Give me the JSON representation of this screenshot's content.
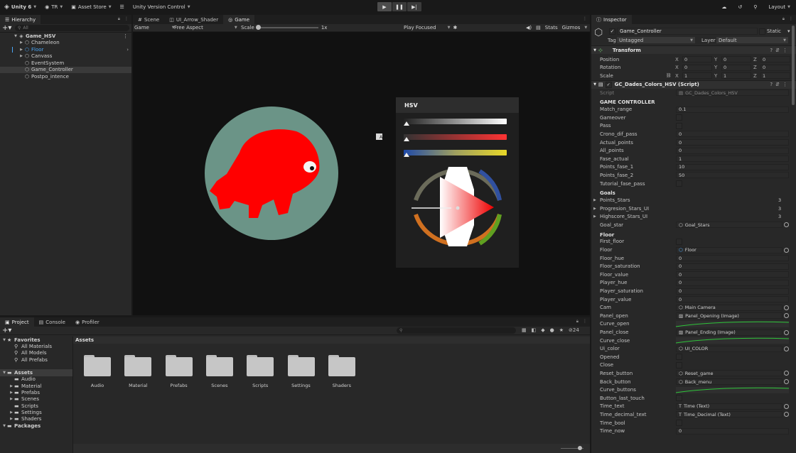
{
  "toolbar": {
    "account": "Unity 6",
    "user": "TR",
    "asset_store": "Asset Store",
    "version_control": "Unity Version Control",
    "layout": "Layout"
  },
  "hierarchy": {
    "tab": "Hierarchy",
    "search_placeholder": "All",
    "scene": "Game_HSV",
    "items": [
      {
        "label": "Chameleon",
        "expand": true,
        "prefab": false,
        "selected": false,
        "blue": false
      },
      {
        "label": "Floor",
        "expand": true,
        "prefab": true,
        "selected": false,
        "blue": true
      },
      {
        "label": "Canvass",
        "expand": true,
        "prefab": false,
        "selected": false,
        "blue": false
      },
      {
        "label": "EventSystem",
        "expand": false,
        "prefab": false,
        "selected": false,
        "blue": false
      },
      {
        "label": "Game_Controller",
        "expand": false,
        "prefab": false,
        "selected": true,
        "blue": false
      },
      {
        "label": "Postpo_intence",
        "expand": false,
        "prefab": false,
        "selected": false,
        "blue": false
      }
    ]
  },
  "center_tabs": [
    "Scene",
    "UI_Arrow_Shader",
    "Game"
  ],
  "game_toolbar": {
    "display": "Game",
    "aspect": "Free Aspect",
    "scale_label": "Scale",
    "scale_value": "1x",
    "play_mode": "Play Focused",
    "stats": "Stats",
    "gizmos": "Gizmos"
  },
  "game_view": {
    "hsv_title": "HSV",
    "marker": "A",
    "hue_fraction": 0,
    "saturation_fraction": 0,
    "value_fraction": 0
  },
  "project": {
    "tabs": [
      "Project",
      "Console",
      "Profiler"
    ],
    "assets_title": "Assets",
    "search_count": "24",
    "tree": [
      {
        "label": "Favorites",
        "level": 0,
        "bold": true,
        "expand": true,
        "icon": "star"
      },
      {
        "label": "All Materials",
        "level": 1,
        "bold": false,
        "expand": false,
        "icon": "search"
      },
      {
        "label": "All Models",
        "level": 1,
        "bold": false,
        "expand": false,
        "icon": "search"
      },
      {
        "label": "All Prefabs",
        "level": 1,
        "bold": false,
        "expand": false,
        "icon": "search"
      },
      {
        "label": "",
        "level": 0,
        "bold": false,
        "expand": false,
        "icon": "none"
      },
      {
        "label": "Assets",
        "level": 0,
        "bold": true,
        "expand": true,
        "icon": "folder",
        "selected": true
      },
      {
        "label": "Audio",
        "level": 1,
        "bold": false,
        "expand": false,
        "icon": "folder"
      },
      {
        "label": "Material",
        "level": 1,
        "bold": false,
        "expand": true,
        "icon": "folder"
      },
      {
        "label": "Prefabs",
        "level": 1,
        "bold": false,
        "expand": true,
        "icon": "folder"
      },
      {
        "label": "Scenes",
        "level": 1,
        "bold": false,
        "expand": true,
        "icon": "folder"
      },
      {
        "label": "Scripts",
        "level": 1,
        "bold": false,
        "expand": false,
        "icon": "folder"
      },
      {
        "label": "Settings",
        "level": 1,
        "bold": false,
        "expand": true,
        "icon": "folder"
      },
      {
        "label": "Shaders",
        "level": 1,
        "bold": false,
        "expand": true,
        "icon": "folder"
      },
      {
        "label": "Packages",
        "level": 0,
        "bold": true,
        "expand": true,
        "icon": "folder"
      }
    ],
    "folders": [
      "Audio",
      "Material",
      "Prefabs",
      "Scenes",
      "Scripts",
      "Settings",
      "Shaders"
    ]
  },
  "inspector": {
    "tab": "Inspector",
    "object_name": "Game_Controller",
    "static_label": "Static",
    "tag_label": "Tag",
    "tag_value": "Untagged",
    "layer_label": "Layer",
    "layer_value": "Default",
    "transform": {
      "title": "Transform",
      "rows": [
        {
          "label": "Position",
          "x": "0",
          "y": "0",
          "z": "0"
        },
        {
          "label": "Rotation",
          "x": "0",
          "y": "0",
          "z": "0"
        },
        {
          "label": "Scale",
          "x": "1",
          "y": "1",
          "z": "1"
        }
      ]
    },
    "script_component": {
      "title": "GC_Dades_Colors_HSV (Script)",
      "script_label": "Script",
      "script_value": "GC_Dades_Colors_HSV"
    },
    "sections": [
      {
        "header": "GAME CONTROLLER",
        "rows": [
          {
            "label": "Match_range",
            "type": "text",
            "value": "0.1"
          },
          {
            "label": "Gameover",
            "type": "check"
          },
          {
            "label": "Pass",
            "type": "check"
          },
          {
            "label": "Crono_dif_pass",
            "type": "text",
            "value": "0"
          },
          {
            "label": "Actual_points",
            "type": "text",
            "value": "0"
          },
          {
            "label": "All_points",
            "type": "text",
            "value": "0"
          },
          {
            "label": "Fase_actual",
            "type": "text",
            "value": "1"
          },
          {
            "label": "Points_fase_1",
            "type": "text",
            "value": "10"
          },
          {
            "label": "Points_fase_2",
            "type": "text",
            "value": "50"
          },
          {
            "label": "Tutorial_fase_pass",
            "type": "check"
          }
        ]
      },
      {
        "header": "Goals",
        "rows": [
          {
            "label": "Points_Stars",
            "type": "count",
            "value": "3"
          },
          {
            "label": "Progresion_Stars_UI",
            "type": "count",
            "value": "3"
          },
          {
            "label": "Highscore_Stars_UI",
            "type": "count",
            "value": "3"
          },
          {
            "label": "Goal_star",
            "type": "ref",
            "value": "Goal_Stars"
          }
        ]
      },
      {
        "header": "Floor",
        "rows": [
          {
            "label": "First_floor",
            "type": "check"
          },
          {
            "label": "Floor",
            "type": "ref",
            "value": "Floor"
          },
          {
            "label": "Floor_hue",
            "type": "text",
            "value": "0"
          },
          {
            "label": "Floor_saturation",
            "type": "text",
            "value": "0"
          },
          {
            "label": "Floor_value",
            "type": "text",
            "value": "0"
          },
          {
            "label": "Player_hue",
            "type": "text",
            "value": "0"
          },
          {
            "label": "Player_saturation",
            "type": "text",
            "value": "0"
          },
          {
            "label": "Player_value",
            "type": "text",
            "value": "0"
          },
          {
            "label": "Cam",
            "type": "ref",
            "value": "Main Camera"
          },
          {
            "label": "Panel_open",
            "type": "ref",
            "value": "Panel_Opening (Image)"
          },
          {
            "label": "Curve_open",
            "type": "curve"
          },
          {
            "label": "Panel_close",
            "type": "ref",
            "value": "Panel_Ending (Image)"
          },
          {
            "label": "Curve_close",
            "type": "curve"
          },
          {
            "label": "Ui_color",
            "type": "ref",
            "value": "UI_COLOR"
          },
          {
            "label": "Opened",
            "type": "check"
          },
          {
            "label": "Close",
            "type": "check"
          },
          {
            "label": "Reset_button",
            "type": "ref",
            "value": "Reset_game"
          },
          {
            "label": "Back_button",
            "type": "ref",
            "value": "Back_menu"
          },
          {
            "label": "Curve_buttons",
            "type": "curve"
          },
          {
            "label": "Button_last_touch",
            "type": "check"
          },
          {
            "label": "Time_text",
            "type": "ref",
            "value": "Time (Text)"
          },
          {
            "label": "Time_decimal_text",
            "type": "ref",
            "value": "Time_Decimal (Text)"
          },
          {
            "label": "Time_bool",
            "type": "check"
          },
          {
            "label": "Time_now",
            "type": "text",
            "value": "0"
          }
        ]
      }
    ]
  },
  "colors": {
    "floor_disc": "#6b9487",
    "chameleon": "#ff0000",
    "accent": "#4ba6f5",
    "curve": "#2fc43a"
  }
}
